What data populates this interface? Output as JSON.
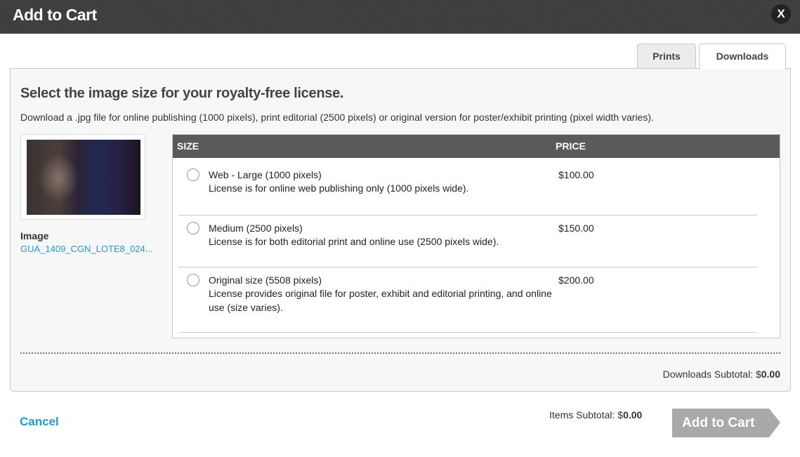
{
  "dialog": {
    "title": "Add to Cart",
    "close_label": "X"
  },
  "tabs": [
    {
      "label": "Prints"
    },
    {
      "label": "Downloads"
    }
  ],
  "main": {
    "heading": "Select the image size for your royalty-free license.",
    "description": "Download a .jpg file for online publishing (1000 pixels), print editorial (2500 pixels) or original version for poster/exhibit printing (pixel width varies).",
    "image_label": "Image",
    "image_filename": "GUA_1409_CGN_LOTE8_024..."
  },
  "table": {
    "headers": {
      "size": "SIZE",
      "price": "PRICE"
    },
    "options": [
      {
        "name": "Web - Large (1000 pixels)",
        "description": "License is for online web publishing only (1000 pixels wide).",
        "price": "$100.00"
      },
      {
        "name": "Medium (2500 pixels)",
        "description": "License is for both editorial print and online use (2500 pixels wide).",
        "price": "$150.00"
      },
      {
        "name": "Original size (5508 pixels)",
        "description": "License provides original file for poster, exhibit and editorial printing, and online use (size varies).",
        "price": "$200.00"
      }
    ]
  },
  "downloads_subtotal": {
    "label": "Downloads Subtotal: $",
    "value": "0.00"
  },
  "footer": {
    "cancel_label": "Cancel",
    "items_subtotal_label": "Items Subtotal: $",
    "items_subtotal_value": "0.00",
    "add_to_cart_label": "Add to Cart"
  },
  "colors": {
    "link": "#1e9ad6",
    "header_bg": "#5a5a5a",
    "button_bg": "#a9a9a9",
    "titlebar_bg": "#3d3d3d"
  }
}
